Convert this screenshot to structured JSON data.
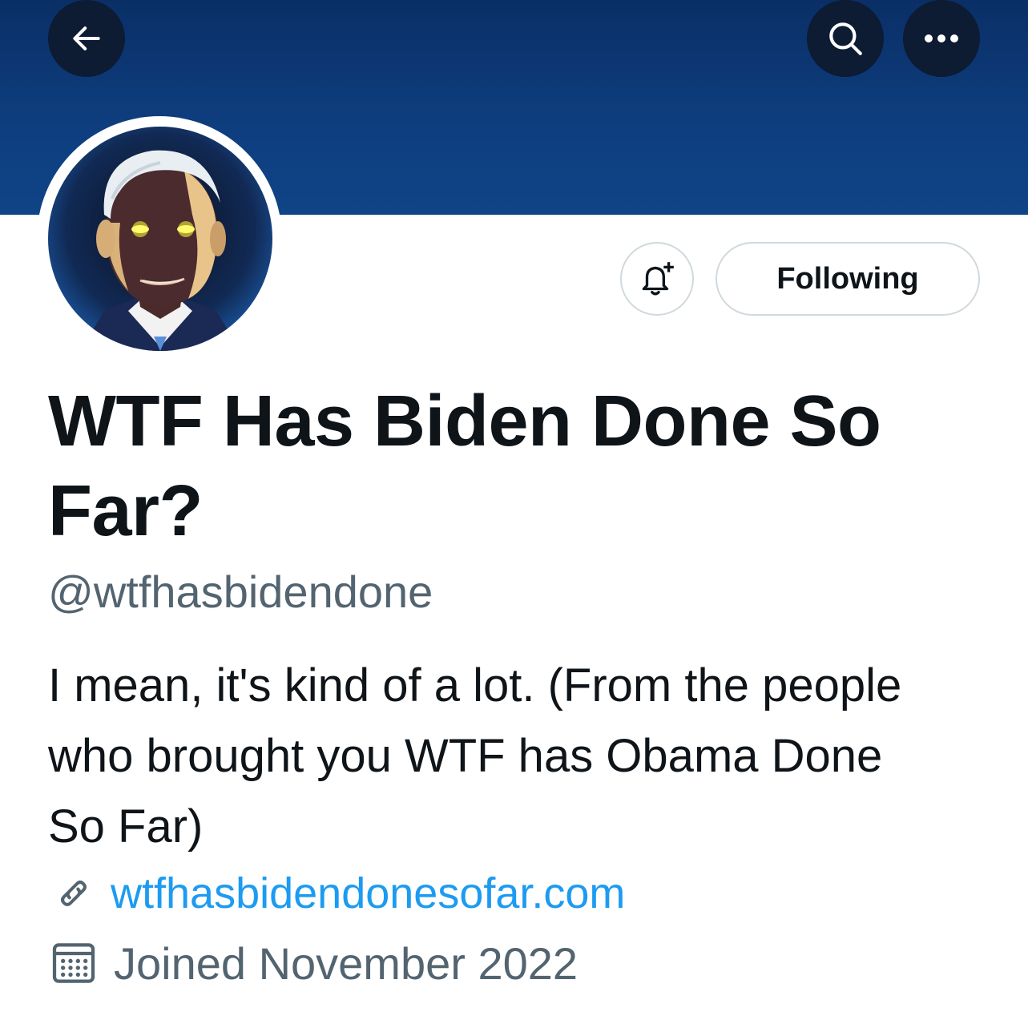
{
  "colors": {
    "banner": "#0e3d7e",
    "button_bg": "#0d1b33",
    "text_primary": "#0f1419",
    "text_secondary": "#536471",
    "link": "#1d9bf0",
    "border": "#cfd9de"
  },
  "header": {
    "back_icon": "arrow-left-icon",
    "search_icon": "search-icon",
    "more_icon": "more-horizontal-icon"
  },
  "profile": {
    "display_name": "WTF Has Biden Done So Far?",
    "handle": "@wtfhasbidendone",
    "bio": "I mean, it's kind of a lot. (From the people who brought you WTF has Obama Done So Far)",
    "website": "wtfhasbidendonesofar.com",
    "joined": "Joined November 2022"
  },
  "actions": {
    "notify_icon": "bell-plus-icon",
    "following_label": "Following"
  }
}
